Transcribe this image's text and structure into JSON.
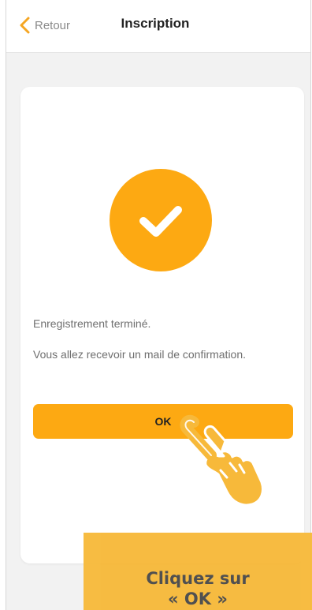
{
  "navbar": {
    "back_label": "Retour",
    "title": "Inscription"
  },
  "card": {
    "message_1": "Enregistrement terminé.",
    "message_2": "Vous allez recevoir un mail de confirmation.",
    "ok_label": "OK"
  },
  "callout": {
    "line_1": "Cliquez sur",
    "line_2": "« OK »"
  },
  "icons": {
    "back": "chevron-left-icon",
    "success": "checkmark-circle-icon",
    "pointer": "hand-pointer-icon"
  },
  "colors": {
    "accent": "#fda912",
    "callout": "#f7b93a"
  }
}
